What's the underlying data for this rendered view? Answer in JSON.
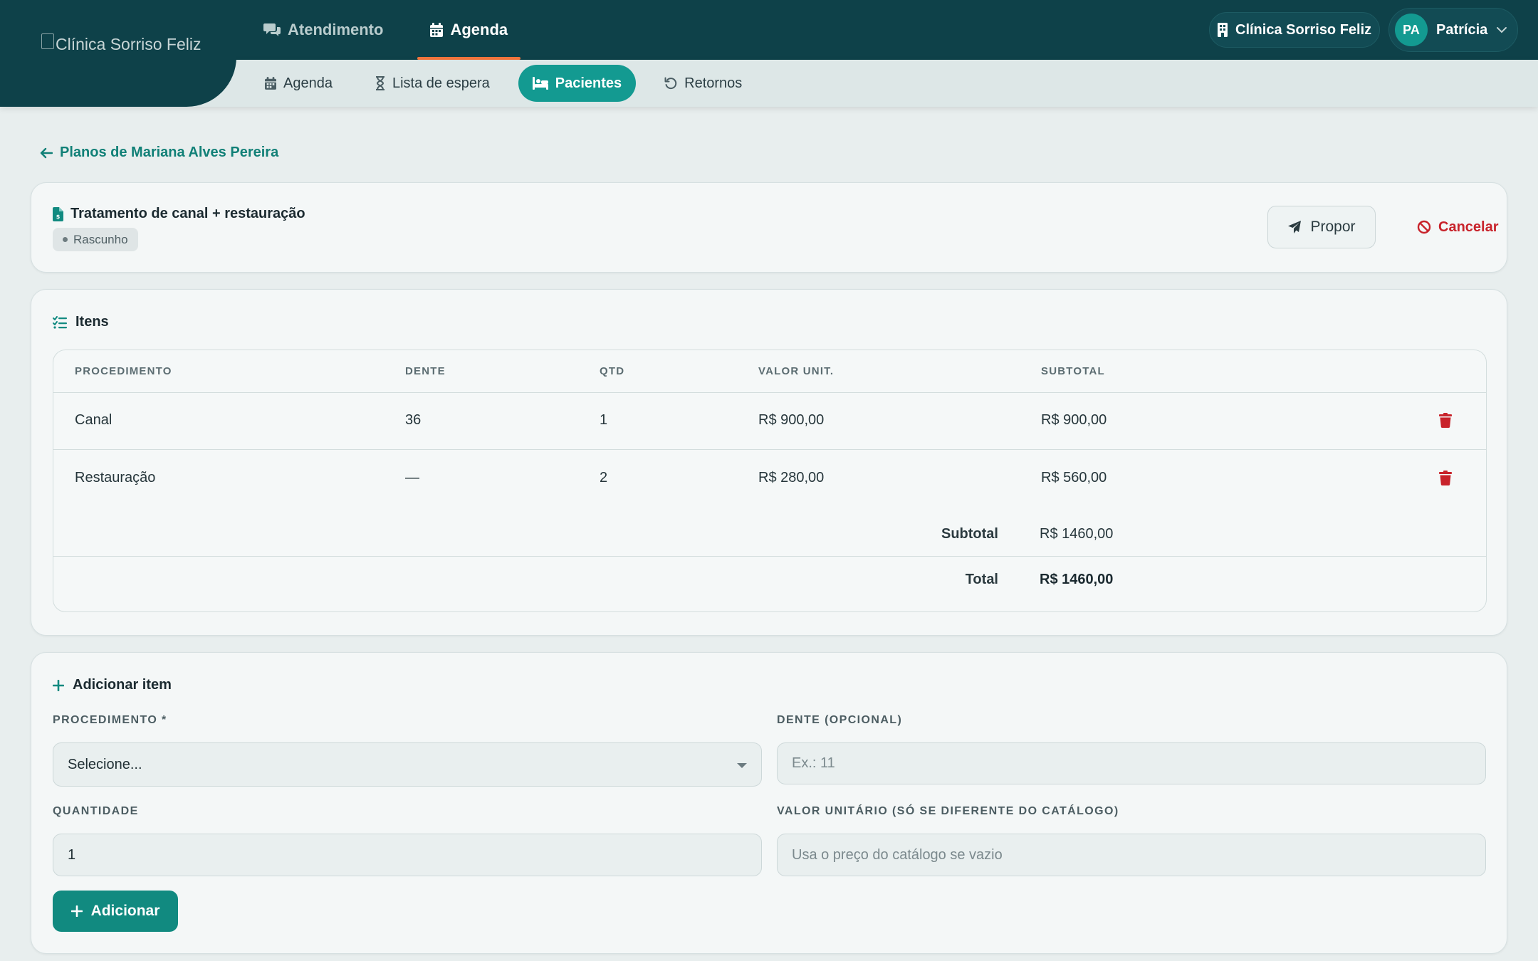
{
  "brand": {
    "logo_alt": "Clínica Sorriso Feliz"
  },
  "main_nav": [
    {
      "label": "Atendimento",
      "icon": "chat-bubbles-icon",
      "active": false
    },
    {
      "label": "Agenda",
      "icon": "calendar-icon",
      "active": true
    }
  ],
  "sub_nav": [
    {
      "label": "Agenda",
      "icon": "calendar-icon",
      "active": false
    },
    {
      "label": "Lista de espera",
      "icon": "hourglass-icon",
      "active": false
    },
    {
      "label": "Pacientes",
      "icon": "patient-icon",
      "active": true
    },
    {
      "label": "Retornos",
      "icon": "undo-icon",
      "active": false
    }
  ],
  "header": {
    "clinic_name": "Clínica Sorriso Feliz",
    "user_initials": "PA",
    "user_name": "Patrícia"
  },
  "colors": {
    "topbar": "#0e4149",
    "accent": "#139a91",
    "active_underline": "#f0743c",
    "danger": "#c8232b"
  },
  "back_link": "Planos de Mariana Alves Pereira",
  "plan": {
    "title": "Tratamento de canal + restauração",
    "status": "Rascunho",
    "propose_label": "Propor",
    "cancel_label": "Cancelar"
  },
  "items": {
    "title": "Itens",
    "columns": [
      "PROCEDIMENTO",
      "DENTE",
      "QTD",
      "VALOR UNIT.",
      "SUBTOTAL"
    ],
    "rows": [
      {
        "procedimento": "Canal",
        "dente": "36",
        "qtd": "1",
        "valor_unit": "R$ 900,00",
        "subtotal": "R$ 900,00"
      },
      {
        "procedimento": "Restauração",
        "dente": "—",
        "qtd": "2",
        "valor_unit": "R$ 280,00",
        "subtotal": "R$ 560,00"
      }
    ],
    "subtotal_label": "Subtotal",
    "subtotal_value": "R$ 1460,00",
    "total_label": "Total",
    "total_value": "R$ 1460,00"
  },
  "add_item": {
    "title": "Adicionar item",
    "procedimento_label": "PROCEDIMENTO *",
    "procedimento_value": "Selecione...",
    "dente_label": "DENTE (OPCIONAL)",
    "dente_placeholder": "Ex.: 11",
    "quantidade_label": "QUANTIDADE",
    "quantidade_value": "1",
    "valor_label": "VALOR UNITÁRIO (SÓ SE DIFERENTE DO CATÁLOGO)",
    "valor_placeholder": "Usa o preço do catálogo se vazio",
    "submit_label": "Adicionar"
  }
}
